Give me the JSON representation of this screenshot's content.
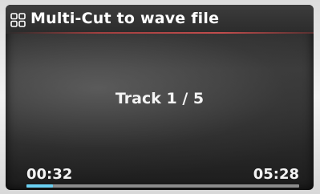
{
  "header": {
    "title": "Multi-Cut to wave file",
    "menu_icon": "grid-menu-icon"
  },
  "main": {
    "track_label": "Track 1 / 5"
  },
  "playback": {
    "elapsed": "00:32",
    "total": "05:28",
    "progress_fraction": 0.098
  },
  "colors": {
    "progress_fill": "#6ad0f2",
    "title_underline": "#d25050",
    "text": "#ffffff"
  }
}
